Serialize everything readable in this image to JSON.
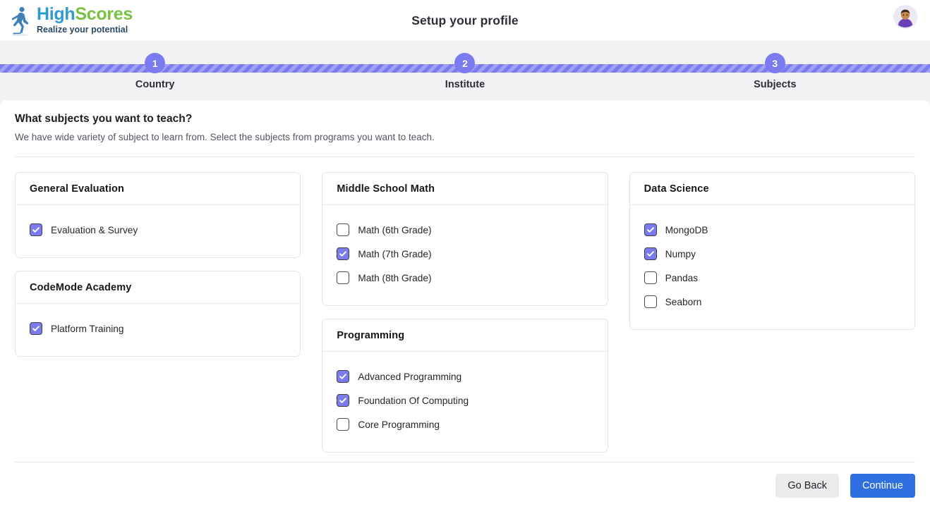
{
  "header": {
    "logo": {
      "icon": "runner-icon",
      "name_part1": "High",
      "name_part2": "Scores",
      "tagline": "Realize your potential",
      "color_part1": "#2e9ad0",
      "color_part2": "#7ac143"
    },
    "title": "Setup your profile",
    "avatar": "user-avatar"
  },
  "stepper": {
    "accent": "#7b7bf0",
    "steps": [
      {
        "number": "1",
        "label": "Country"
      },
      {
        "number": "2",
        "label": "Institute"
      },
      {
        "number": "3",
        "label": "Subjects"
      }
    ]
  },
  "main": {
    "heading": "What subjects you want to teach?",
    "subheading": "We have wide variety of subject to learn from. Select the subjects from programs you want to teach.",
    "columns": [
      {
        "cards": [
          {
            "title": "General Evaluation",
            "options": [
              {
                "label": "Evaluation & Survey",
                "checked": true
              }
            ]
          },
          {
            "title": "CodeMode Academy",
            "options": [
              {
                "label": "Platform Training",
                "checked": true
              }
            ]
          }
        ]
      },
      {
        "cards": [
          {
            "title": "Middle School Math",
            "options": [
              {
                "label": "Math (6th Grade)",
                "checked": false
              },
              {
                "label": "Math (7th Grade)",
                "checked": true
              },
              {
                "label": "Math (8th Grade)",
                "checked": false
              }
            ]
          },
          {
            "title": "Programming",
            "options": [
              {
                "label": "Advanced Programming",
                "checked": true
              },
              {
                "label": "Foundation Of Computing",
                "checked": true
              },
              {
                "label": "Core Programming",
                "checked": false
              }
            ]
          }
        ]
      },
      {
        "cards": [
          {
            "title": "Data Science",
            "options": [
              {
                "label": "MongoDB",
                "checked": true
              },
              {
                "label": "Numpy",
                "checked": true
              },
              {
                "label": "Pandas",
                "checked": false
              },
              {
                "label": "Seaborn",
                "checked": false
              }
            ]
          }
        ]
      }
    ]
  },
  "footer": {
    "back_label": "Go Back",
    "continue_label": "Continue",
    "back_color": "#ebebed",
    "continue_color": "#2f6fe0"
  }
}
